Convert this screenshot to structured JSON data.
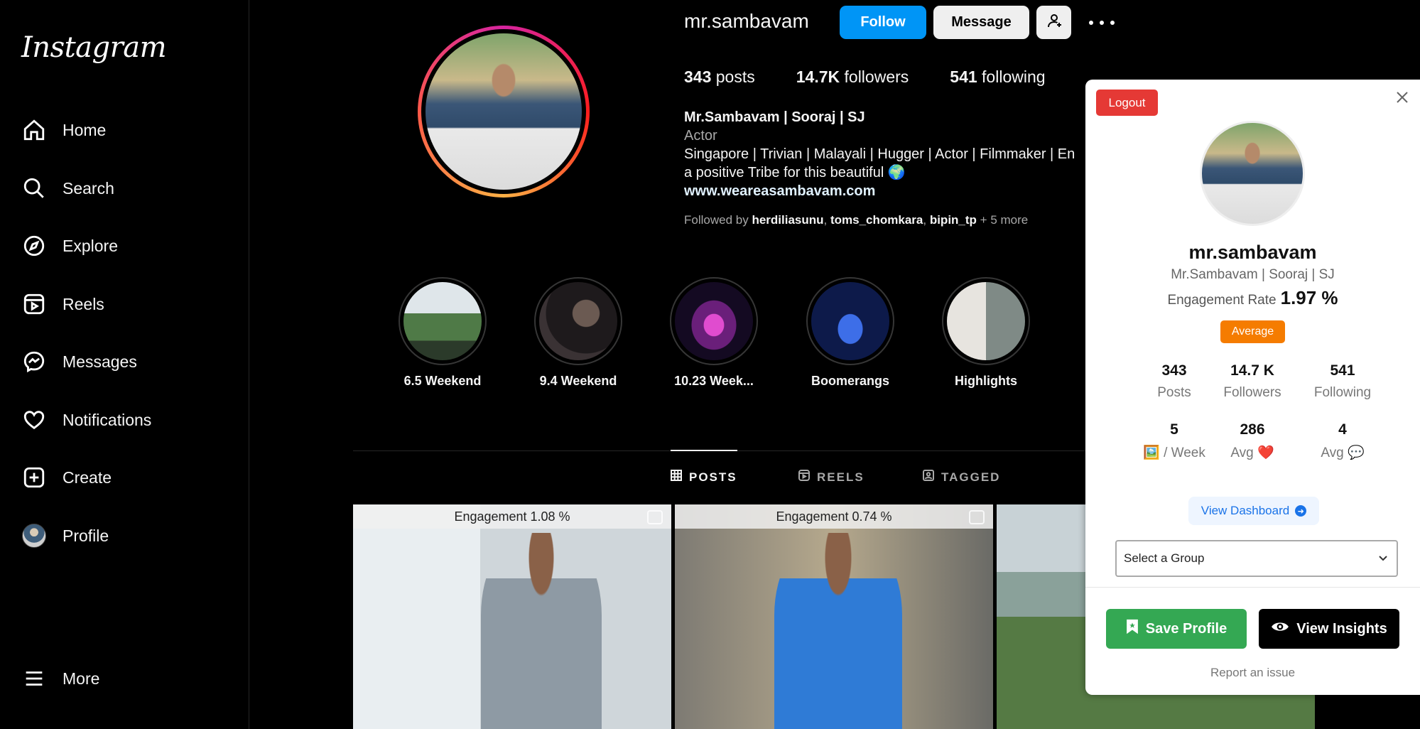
{
  "sidebar": {
    "logo": "Instagram",
    "items": [
      {
        "label": "Home",
        "icon": "home-icon"
      },
      {
        "label": "Search",
        "icon": "search-icon"
      },
      {
        "label": "Explore",
        "icon": "compass-icon"
      },
      {
        "label": "Reels",
        "icon": "reels-icon"
      },
      {
        "label": "Messages",
        "icon": "messenger-icon"
      },
      {
        "label": "Notifications",
        "icon": "heart-icon"
      },
      {
        "label": "Create",
        "icon": "plus-square-icon"
      },
      {
        "label": "Profile",
        "icon": "avatar"
      }
    ],
    "more_label": "More"
  },
  "profile": {
    "username": "mr.sambavam",
    "follow_label": "Follow",
    "message_label": "Message",
    "stats": {
      "posts": "343",
      "posts_label": "posts",
      "followers": "14.7K",
      "followers_label": "followers",
      "following": "541",
      "following_label": "following"
    },
    "full_name": "Mr.Sambavam | Sooraj | SJ",
    "category": "Actor",
    "bio_line1": "Singapore | Trivian | Malayali | Hugger | Actor | Filmmaker | En",
    "bio_line2": "a positive Tribe for this beautiful 🌍",
    "website": "www.weareasambavam.com",
    "followed_by_prefix": "Followed by",
    "followed_by": [
      "herdiliasunu",
      "toms_chomkara",
      "bipin_tp"
    ],
    "followed_by_more": "+ 5 more"
  },
  "highlights": [
    {
      "label": "6.5 Weekend"
    },
    {
      "label": "9.4 Weekend"
    },
    {
      "label": "10.23 Week..."
    },
    {
      "label": "Boomerangs"
    },
    {
      "label": "Highlights"
    }
  ],
  "tabs": [
    {
      "label": "POSTS",
      "active": true
    },
    {
      "label": "REELS",
      "active": false
    },
    {
      "label": "TAGGED",
      "active": false
    }
  ],
  "posts": [
    {
      "engagement": "Engagement 1.08 %"
    },
    {
      "engagement": "Engagement 0.74 %"
    },
    {
      "engagement": ""
    }
  ],
  "panel": {
    "logout_label": "Logout",
    "username": "mr.sambavam",
    "full_name": "Mr.Sambavam | Sooraj | SJ",
    "engagement_label": "Engagement Rate",
    "engagement_value": "1.97 %",
    "badge": "Average",
    "badge_color": "#f57c00",
    "stats_row1": [
      {
        "value": "343",
        "label": "Posts"
      },
      {
        "value": "14.7 K",
        "label": "Followers"
      },
      {
        "value": "541",
        "label": "Following"
      }
    ],
    "stats_row2": [
      {
        "value": "5",
        "label": "🖼️ / Week"
      },
      {
        "value": "286",
        "label": "Avg ❤️"
      },
      {
        "value": "4",
        "label": "Avg 💬"
      }
    ],
    "view_dashboard_label": "View Dashboard",
    "select_group_value": "Select a Group",
    "save_profile_label": "Save Profile",
    "view_insights_label": "View Insights",
    "report_label": "Report an issue"
  },
  "colors": {
    "follow_blue": "#0095f6",
    "logout_red": "#e53935",
    "save_green": "#34a853"
  }
}
